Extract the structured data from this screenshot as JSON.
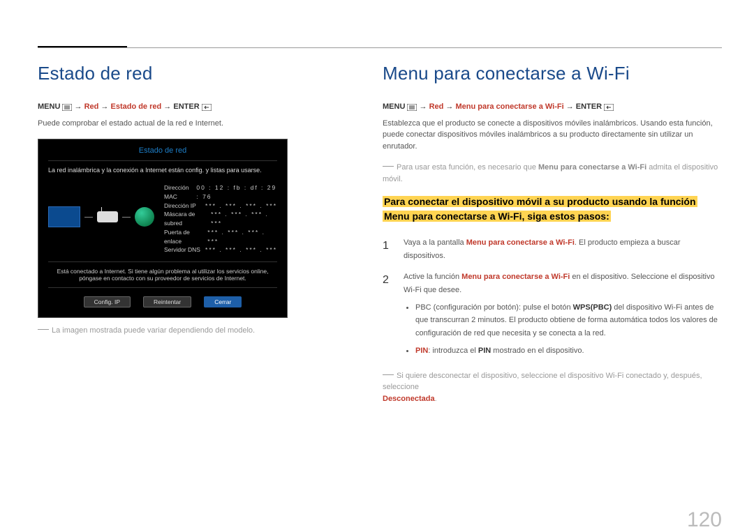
{
  "page_number": "120",
  "left": {
    "heading": "Estado de red",
    "breadcrumb": {
      "menu": "MENU",
      "sep": " → ",
      "red": "Red",
      "item": "Estado de red",
      "enter": "ENTER"
    },
    "desc": "Puede comprobar el estado actual de la red e Internet.",
    "tv": {
      "title": "Estado de red",
      "msg": "La red inalámbrica y la conexión a Internet están config. y listas para usarse.",
      "rows": [
        {
          "label": "Dirección MAC",
          "value": "00 : 12 : fb : df : 29 : 76"
        },
        {
          "label": "Dirección IP",
          "value": "*** . *** . *** . ***"
        },
        {
          "label": "Máscara de subred",
          "value": "*** . *** . *** . ***"
        },
        {
          "label": "Puerta de enlace",
          "value": "*** . *** . *** . ***"
        },
        {
          "label": "Servidor DNS",
          "value": "*** . *** . *** . ***"
        }
      ],
      "footer": "Está conectado a Internet. Si tiene algún problema al utilizar los servicios online, póngase en contacto con su proveedor de servicios de Internet.",
      "btn_ip": "Config. IP",
      "btn_retry": "Reintentar",
      "btn_close": "Cerrar"
    },
    "note": "La imagen mostrada puede variar dependiendo del modelo."
  },
  "right": {
    "heading": "Menu para conectarse a Wi-Fi",
    "breadcrumb": {
      "menu": "MENU",
      "sep": " → ",
      "red": "Red",
      "item": "Menu para conectarse a Wi-Fi",
      "enter": "ENTER"
    },
    "desc": "Establezca que el producto se conecte a dispositivos móviles inalámbricos. Usando esta función, puede conectar dispositivos móviles inalámbricos a su producto directamente sin utilizar un enrutador.",
    "note1_pre": "Para usar esta función, es necesario que ",
    "note1_bold": "Menu para conectarse a Wi-Fi",
    "note1_post": " admita el dispositivo móvil.",
    "highlight": "Para conectar el dispositivo móvil a su producto usando la función Menu para conectarse a Wi-Fi, siga estos pasos:",
    "step1_num": "1",
    "step1_a": "Vaya a la pantalla ",
    "step1_b": "Menu para conectarse a Wi-Fi",
    "step1_c": ". El producto empieza a buscar dispositivos.",
    "step2_num": "2",
    "step2_a": "Active la función ",
    "step2_b": "Menu para conectarse a Wi-Fi",
    "step2_c": " en el dispositivo. Seleccione el dispositivo Wi-Fi que desee.",
    "bullet1_a": "PBC (configuración por botón): pulse el botón ",
    "bullet1_b": "WPS(PBC)",
    "bullet1_c": " del dispositivo Wi-Fi antes de que transcurran 2 minutos. El producto obtiene de forma automática todos los valores de configuración de red que necesita y se conecta a la red.",
    "bullet2_a": "PIN",
    "bullet2_b": ": introduzca el ",
    "bullet2_c": "PIN",
    "bullet2_d": " mostrado en el dispositivo.",
    "note2_a": "Si quiere desconectar el dispositivo, seleccione el dispositivo Wi-Fi conectado y, después, seleccione ",
    "note2_b": "Desconectada",
    "note2_c": "."
  }
}
